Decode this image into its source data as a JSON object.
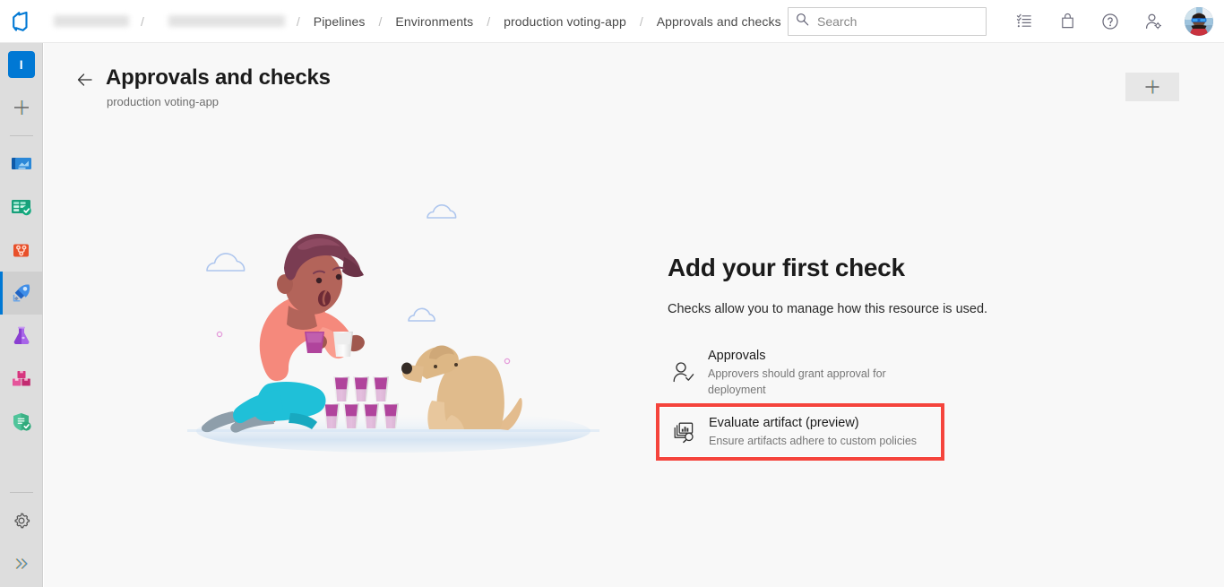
{
  "topbar": {
    "logo_icon": "azure-devops-logo-icon",
    "breadcrumb": [
      {
        "label": "",
        "redacted": true
      },
      {
        "label": "",
        "redacted": true
      },
      {
        "label": "Pipelines",
        "redacted": false
      },
      {
        "label": "Environments",
        "redacted": false
      },
      {
        "label": "production voting-app",
        "redacted": false
      },
      {
        "label": "Approvals and checks",
        "redacted": false
      }
    ],
    "separator": "/",
    "search": {
      "placeholder": "Search",
      "value": "",
      "icon": "search-icon"
    },
    "icons": [
      {
        "name": "tasks-icon",
        "label": "Tasks"
      },
      {
        "name": "marketplace-bag-icon",
        "label": "Marketplace"
      },
      {
        "name": "help-question-icon",
        "label": "Help"
      },
      {
        "name": "user-settings-icon",
        "label": "User settings"
      }
    ],
    "avatar": {
      "name": "user-avatar",
      "label": "Account manager"
    }
  },
  "rail": {
    "project_avatar": {
      "initial": "I",
      "color": "#0078d4"
    },
    "items": [
      {
        "name": "sidebar-item-new",
        "label": "New",
        "icon": "plus-icon"
      },
      {
        "name": "sidebar-item-overview",
        "label": "Overview",
        "icon": "overview-icon"
      },
      {
        "name": "sidebar-item-boards",
        "label": "Boards",
        "icon": "boards-icon"
      },
      {
        "name": "sidebar-item-repos",
        "label": "Repos",
        "icon": "repos-branch-icon"
      },
      {
        "name": "sidebar-item-pipelines",
        "label": "Pipelines",
        "icon": "pipelines-rocket-icon",
        "selected": true
      },
      {
        "name": "sidebar-item-test-plans",
        "label": "Test Plans",
        "icon": "test-flask-icon"
      },
      {
        "name": "sidebar-item-artifacts",
        "label": "Artifacts",
        "icon": "artifacts-boxes-icon"
      },
      {
        "name": "sidebar-item-security",
        "label": "Advanced Security",
        "icon": "shield-check-icon"
      }
    ],
    "bottom_items": [
      {
        "name": "sidebar-item-project-settings",
        "label": "Project settings",
        "icon": "gear-icon"
      },
      {
        "name": "sidebar-item-expand",
        "label": "Expand",
        "icon": "chevron-double-right-icon"
      }
    ]
  },
  "page": {
    "back_icon": "back-arrow-icon",
    "title": "Approvals and checks",
    "subtitle": "production voting-app",
    "add_button": {
      "label": "+",
      "icon": "plus-icon",
      "name": "add-check-button"
    }
  },
  "zero_data": {
    "illustration": "person-stacking-cups-with-dog-illustration",
    "title": "Add your first check",
    "description": "Checks allow you to manage how this resource is used.",
    "checks": [
      {
        "id": "approvals",
        "name": "Approvals",
        "description": "Approvers should grant approval for deployment",
        "icon": "approver-person-check-icon",
        "highlighted": false
      },
      {
        "id": "evaluate-artifact",
        "name": "Evaluate artifact (preview)",
        "description": "Ensure artifacts adhere to custom policies",
        "icon": "evaluate-artifact-magnifier-icon",
        "highlighted": true
      }
    ]
  },
  "colors": {
    "accent": "#0078d4",
    "highlight_box": "#f5443c",
    "rail_bg": "#dddddd",
    "content_bg": "#f8f8f8"
  }
}
